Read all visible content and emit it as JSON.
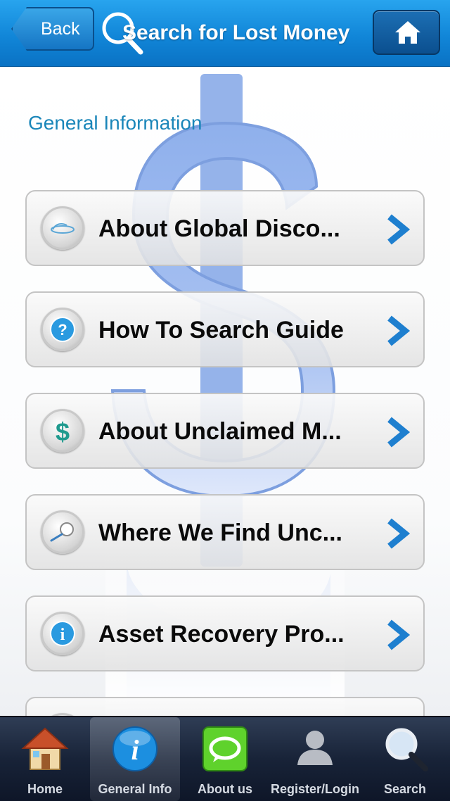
{
  "header": {
    "back_label": "Back",
    "title": "Search for Lost Money",
    "home_icon": "home-icon"
  },
  "content": {
    "section_title": "General Information",
    "items": [
      {
        "label": "About Global Disco...",
        "icon": "globe-icon"
      },
      {
        "label": "How To Search Guide",
        "icon": "question-icon"
      },
      {
        "label": "About Unclaimed M...",
        "icon": "dollar-icon"
      },
      {
        "label": "Where We Find Unc...",
        "icon": "magnifier-icon"
      },
      {
        "label": "Asset Recovery Pro...",
        "icon": "info-icon"
      }
    ]
  },
  "tabbar": {
    "tabs": [
      {
        "label": "Home",
        "icon": "house-icon",
        "active": false
      },
      {
        "label": "General Info",
        "icon": "info-icon",
        "active": true
      },
      {
        "label": "About us",
        "icon": "chat-icon",
        "active": false
      },
      {
        "label": "Register/Login",
        "icon": "user-icon",
        "active": false
      },
      {
        "label": "Search",
        "icon": "search-icon",
        "active": false
      }
    ]
  },
  "colors": {
    "header_blue": "#1186d8",
    "section_title": "#1a86b9",
    "chevron_blue": "#1e7fcf",
    "tabbar_dark": "#182338"
  }
}
